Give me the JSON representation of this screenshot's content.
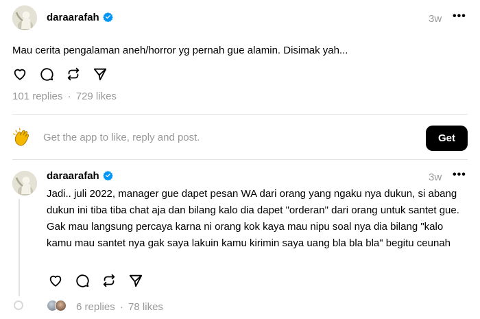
{
  "post": {
    "username": "daraarafah",
    "time": "3w",
    "text": "Mau cerita pengalaman aneh/horror yg pernah gue alamin. Disimak yah...",
    "replies": "101 replies",
    "separator": "·",
    "likes": "729 likes"
  },
  "app_prompt": {
    "text": "Get the app to like, reply and post.",
    "button_label": "Get"
  },
  "reply": {
    "username": "daraarafah",
    "time": "3w",
    "text": "Jadi.. juli 2022, manager gue dapet pesan WA dari orang yang ngaku nya dukun, si abang dukun ini tiba tiba chat aja dan bilang kalo dia dapet \"orderan\" dari orang untuk santet gue. Gak mau langsung percaya  karna ni orang kok kaya mau nipu soal nya dia bilang \"kalo kamu mau santet nya gak saya lakuin kamu kirimin saya uang  bla bla bla\" begitu ceunah",
    "replies": "6 replies",
    "separator": "·",
    "likes": "78 likes"
  },
  "icons": {
    "more": "more-horizontal-icon",
    "like": "heart-icon",
    "reply": "comment-icon",
    "repost": "repost-icon",
    "share": "send-icon",
    "verified": "verified-badge-icon",
    "prompt": "clapping-hands-emoji"
  },
  "colors": {
    "verified": "#0095f6",
    "muted": "#999999",
    "button_bg": "#000000"
  }
}
